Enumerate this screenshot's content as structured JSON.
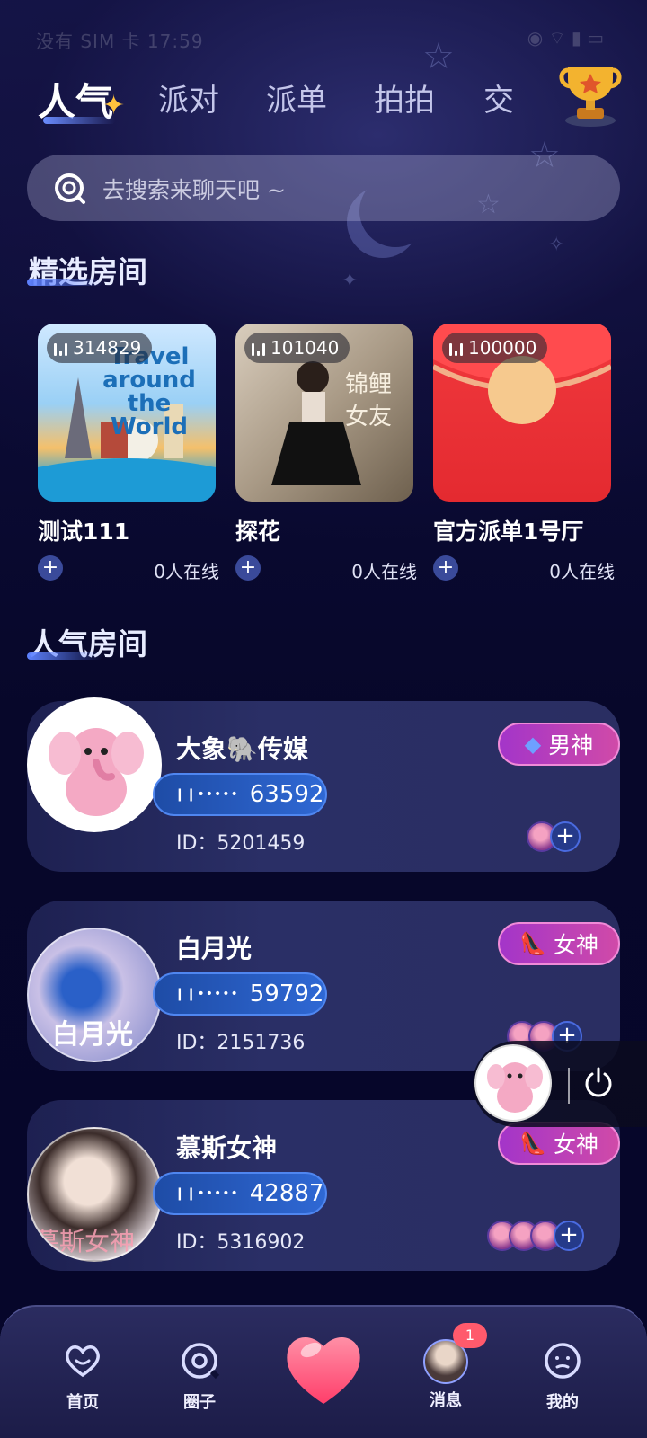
{
  "status_bar": {
    "left_text": "没有 SIM 卡 17:59",
    "right_text": "◉ ⌔ ▮ ▭"
  },
  "tabs": [
    {
      "label": "人气",
      "active": true
    },
    {
      "label": "派对",
      "active": false
    },
    {
      "label": "派单",
      "active": false
    },
    {
      "label": "拍拍",
      "active": false
    },
    {
      "label": "交",
      "active": false
    }
  ],
  "search": {
    "placeholder": "去搜索来聊天吧 ~"
  },
  "featured": {
    "title": "精选房间",
    "rooms": [
      {
        "count": "314829",
        "name": "测试111",
        "online": "0人在线",
        "thumb_text": "Travel around the World"
      },
      {
        "count": "101040",
        "name": "探花",
        "online": "0人在线",
        "thumb_text": "锦鲤 女友"
      },
      {
        "count": "100000",
        "name": "官方派单1号厅",
        "online": "0人在线"
      }
    ]
  },
  "popular": {
    "title": "人气房间",
    "rooms": [
      {
        "name": "大象🐘传媒",
        "heat": "63592",
        "id": "ID：5201459",
        "badge": "男神",
        "badge_icon": "tie-icon",
        "members": 1,
        "avatar_text": ""
      },
      {
        "name": "白月光",
        "heat": "59792",
        "id": "ID：2151736",
        "badge": "女神",
        "badge_icon": "high-heel-icon",
        "members": 2,
        "avatar_text": "白月光"
      },
      {
        "name": "慕斯女神",
        "heat": "42887",
        "id": "ID：5316902",
        "badge": "女神",
        "badge_icon": "high-heel-icon",
        "members": 3,
        "avatar_text": "慕斯女神"
      }
    ]
  },
  "bottom_nav": {
    "home": "首页",
    "circle": "圈子",
    "messages": "消息",
    "messages_badge": "1",
    "me": "我的"
  },
  "colors": {
    "accent": "#4f86f0",
    "badge_bg": "#c03fb8",
    "background": "#0b0b34"
  }
}
